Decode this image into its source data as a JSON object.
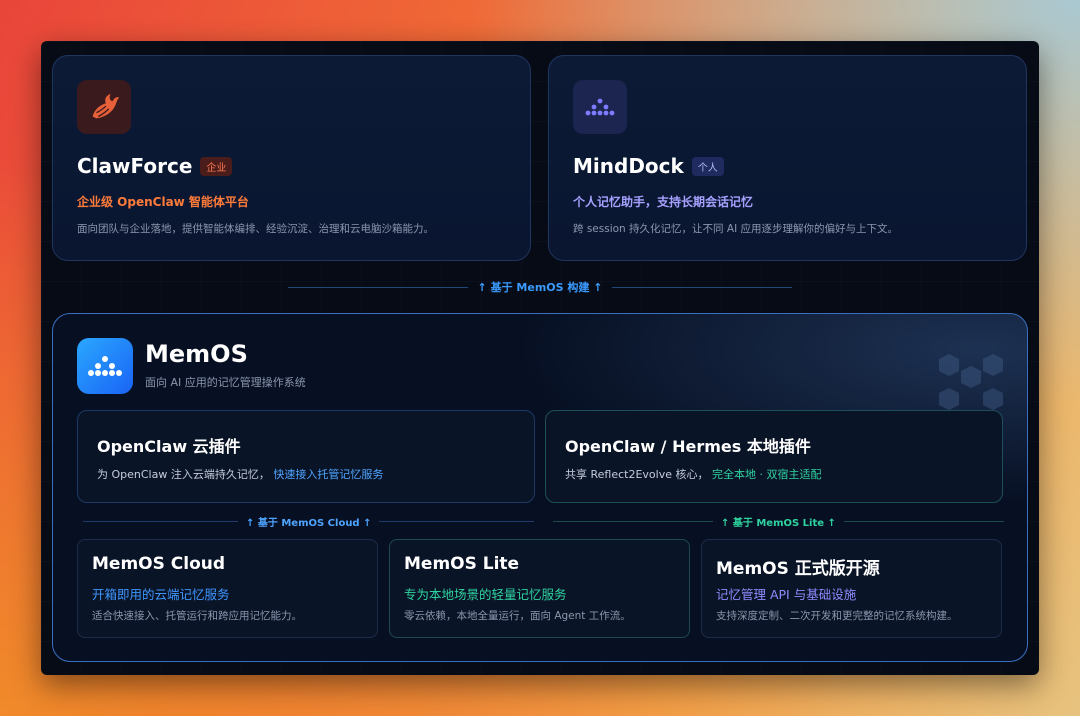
{
  "top_cards": {
    "clawforce": {
      "icon": "lobster-claw-icon",
      "title": "ClawForce",
      "tag": "企业",
      "subtitle": "企业级 OpenClaw 智能体平台",
      "description": "面向团队与企业落地，提供智能体编排、经验沉淀、治理和云电脑沙箱能力。"
    },
    "minddock": {
      "icon": "memos-m-icon",
      "title": "MindDock",
      "tag": "个人",
      "subtitle": "个人记忆助手，支持长期会话记忆",
      "description": "跨 session 持久化记忆，让不同 AI 应用逐步理解你的偏好与上下文。"
    }
  },
  "main_connector": "↑ 基于 MemOS 构建 ↑",
  "memos": {
    "title": "MemOS",
    "subtitle": "面向 AI 应用的记忆管理操作系统"
  },
  "plugins": {
    "cloud": {
      "title": "OpenClaw 云插件",
      "desc_prefix": "为 OpenClaw 注入云端持久记忆，",
      "desc_highlight": "快速接入托管记忆服务"
    },
    "local": {
      "title": "OpenClaw / Hermes 本地插件",
      "desc_prefix": "共享 Reflect2Evolve 核心，",
      "desc_highlight": "完全本地 · 双宿主适配"
    }
  },
  "sub_connectors": {
    "cloud": "↑ 基于 MemOS Cloud ↑",
    "lite": "↑ 基于 MemOS Lite ↑"
  },
  "editions": [
    {
      "title": "MemOS Cloud",
      "subtitle": "开箱即用的云端记忆服务",
      "description": "适合快速接入、托管运行和跨应用记忆能力。"
    },
    {
      "title": "MemOS Lite",
      "subtitle": "专为本地场景的轻量记忆服务",
      "description": "零云依赖，本地全量运行，面向 Agent 工作流。"
    },
    {
      "title": "MemOS 正式版开源",
      "subtitle": "记忆管理 API 与基础设施",
      "description": "支持深度定制、二次开发和更完整的记忆系统构建。"
    }
  ],
  "colors": {
    "accent_blue": "#3b9bff",
    "accent_green": "#2fd3a0",
    "accent_orange": "#ff7b3a",
    "accent_violet": "#a6a0ff"
  }
}
